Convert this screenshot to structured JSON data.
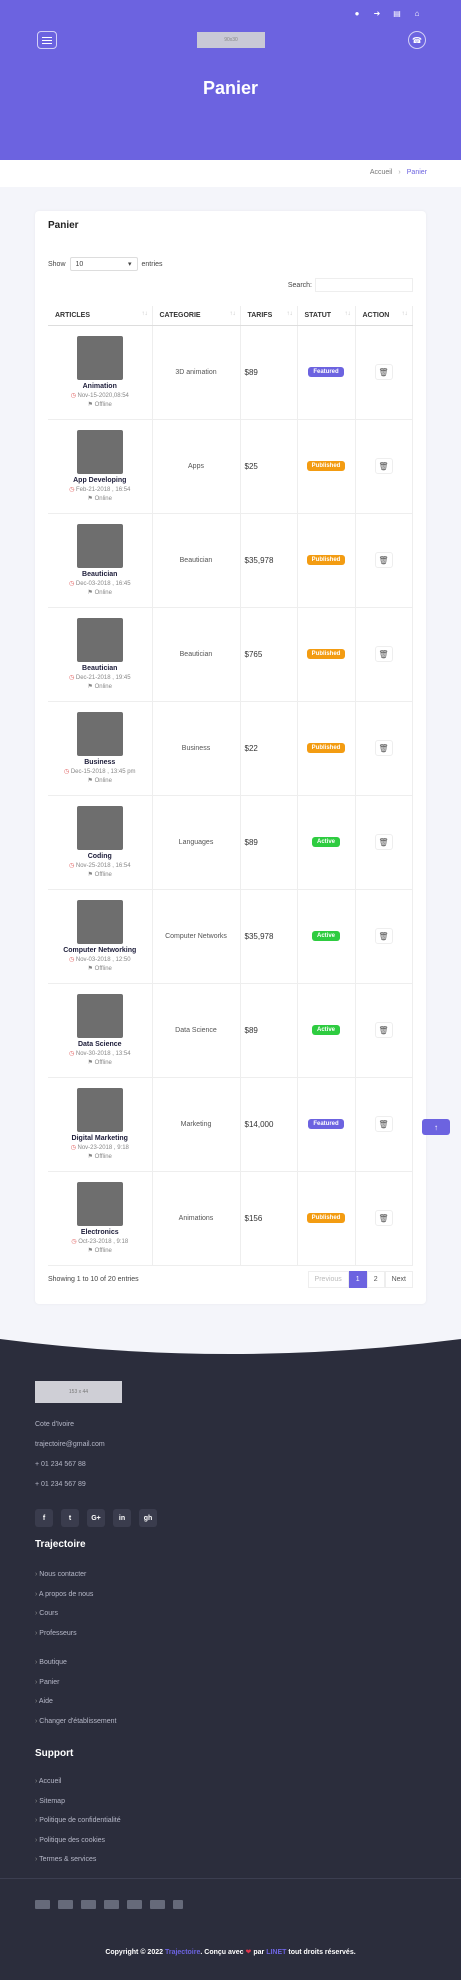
{
  "header": {
    "logo_label": "90x30",
    "title": "Panier",
    "top_icons": [
      "user-icon",
      "sign-in-icon",
      "cart-icon",
      "home-icon"
    ]
  },
  "breadcrumb": {
    "home": "Accueil",
    "current": "Panier"
  },
  "card": {
    "title": "Panier",
    "show_label": "Show",
    "show_value": "10",
    "entries_label": "entries",
    "search_label": "Search:",
    "columns": [
      "ARTICLES",
      "CATEGORIE",
      "TARIFS",
      "STATUT",
      "ACTION"
    ],
    "rows": [
      {
        "name": "Animation",
        "date": "Nov-15-2020,08:54",
        "status": "Offline",
        "category": "3D animation",
        "price": "$89",
        "badge": "Featured",
        "badge_color": "#6c63e0"
      },
      {
        "name": "App Developing",
        "date": "Feb-21-2018 , 16:54",
        "status": "Online",
        "category": "Apps",
        "price": "$25",
        "badge": "Published",
        "badge_color": "#f39c12"
      },
      {
        "name": "Beautician",
        "date": "Dec-03-2018 , 16:45",
        "status": "Online",
        "category": "Beautician",
        "price": "$35,978",
        "badge": "Published",
        "badge_color": "#f39c12"
      },
      {
        "name": "Beautician",
        "date": "Dec-21-2018 , 19:45",
        "status": "Online",
        "category": "Beautician",
        "price": "$765",
        "badge": "Published",
        "badge_color": "#f39c12"
      },
      {
        "name": "Business",
        "date": "Dec-15-2018 , 13:45 pm",
        "status": "Online",
        "category": "Business",
        "price": "$22",
        "badge": "Published",
        "badge_color": "#f39c12"
      },
      {
        "name": "Coding",
        "date": "Nov-25-2018 , 16:54",
        "status": "Offline",
        "category": "Languages",
        "price": "$89",
        "badge": "Active",
        "badge_color": "#2ecc40"
      },
      {
        "name": "Computer Networking",
        "date": "Nov-03-2018 , 12:50",
        "status": "Offline",
        "category": "Computer Networks",
        "price": "$35,978",
        "badge": "Active",
        "badge_color": "#2ecc40"
      },
      {
        "name": "Data Science",
        "date": "Nov-30-2018 , 13:54",
        "status": "Offline",
        "category": "Data Science",
        "price": "$89",
        "badge": "Active",
        "badge_color": "#2ecc40"
      },
      {
        "name": "Digital Marketing",
        "date": "Nov-23-2018 , 9:18",
        "status": "Offline",
        "category": "Marketing",
        "price": "$14,000",
        "badge": "Featured",
        "badge_color": "#6c63e0"
      },
      {
        "name": "Electronics",
        "date": "Oct-23-2018 , 9:18",
        "status": "Offline",
        "category": "Animations",
        "price": "$156",
        "badge": "Published",
        "badge_color": "#f39c12"
      }
    ],
    "info": "Showing 1 to 10 of 20 entries",
    "pager": {
      "prev": "Previous",
      "p1": "1",
      "p2": "2",
      "next": "Next"
    }
  },
  "footer": {
    "logo_label": "153 x 44",
    "address": "Cote d'Ivoire",
    "email": "trajectoire@gmail.com",
    "phone1": "+ 01 234 567 88",
    "phone2": "+ 01 234 567 89",
    "social": [
      "f",
      "t",
      "G+",
      "in",
      "gh"
    ],
    "heading1": "Trajectoire",
    "links1": [
      "Nous contacter",
      "A propos de nous",
      "Cours",
      "Professeurs"
    ],
    "links2": [
      "Boutique",
      "Panier",
      "Aide",
      "Changer d'établissement"
    ],
    "heading2": "Support",
    "links3": [
      "Accueil",
      "Sitemap",
      "Politique de confidentialité",
      "Politique des cookies",
      "Termes & services"
    ],
    "copy_pre": "Copyright © 2022 ",
    "copy_brand": "Trajectoire",
    "copy_mid": ". Conçu avec ",
    "copy_heart": "❤",
    "copy_par": " par ",
    "copy_author": "LINET",
    "copy_end": " tout droits réservés.",
    "accent": "#6c63e0"
  }
}
